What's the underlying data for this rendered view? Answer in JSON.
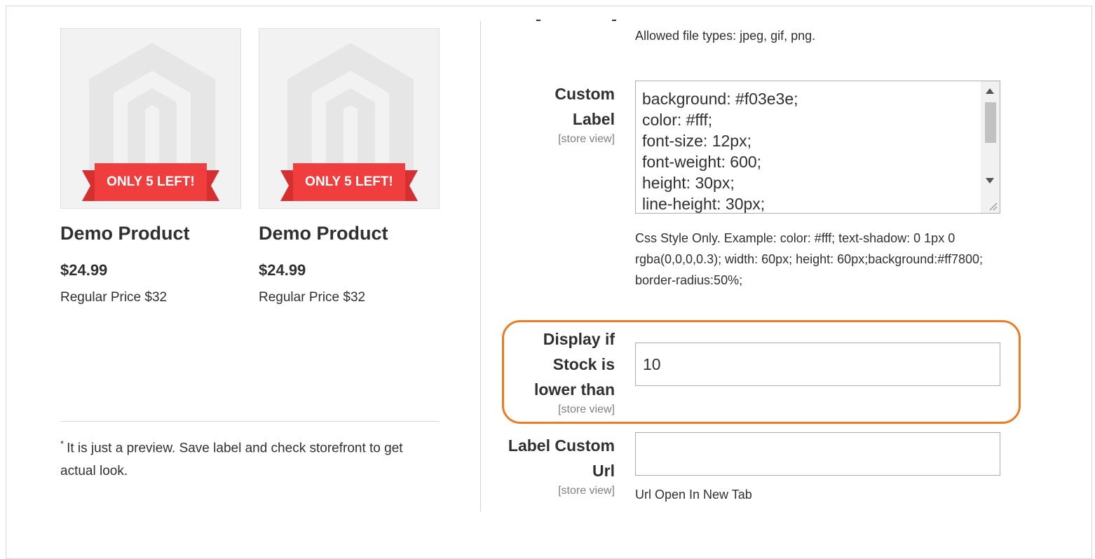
{
  "preview": {
    "products": [
      {
        "badge": "ONLY 5 LEFT!",
        "name": "Demo Product",
        "price": "$24.99",
        "regular_price": "Regular Price $32"
      },
      {
        "badge": "ONLY 5 LEFT!",
        "name": "Demo Product",
        "price": "$24.99",
        "regular_price": "Regular Price $32"
      }
    ],
    "note_star": "*",
    "note_text": "It is just a preview. Save label and check storefront to get actual look."
  },
  "form": {
    "image_note": "Allowed file types: jpeg, gif, png.",
    "custom_label": {
      "label": "Custom Label",
      "scope": "[store view]",
      "value": "background: #f03e3e;\ncolor: #fff;\nfont-size: 12px;\nfont-weight: 600;\nheight: 30px;\nline-height: 30px;",
      "note": "Css Style Only. Example: color: #fff; text-shadow: 0 1px 0 rgba(0,0,0,0.3); width: 60px; height: 60px;background:#ff7800; border-radius:50%;"
    },
    "stock_threshold": {
      "label": "Display if Stock is lower than",
      "scope": "[store view]",
      "value": "10"
    },
    "custom_url": {
      "label": "Label Custom Url",
      "scope": "[store view]",
      "value": "",
      "note": "Url Open In New Tab"
    }
  },
  "colors": {
    "badge": "#f03e3e",
    "highlight": "#f07a22"
  },
  "icons": [
    "magento-logo-icon",
    "scroll-up-icon",
    "scroll-down-icon",
    "resize-grip-icon"
  ]
}
